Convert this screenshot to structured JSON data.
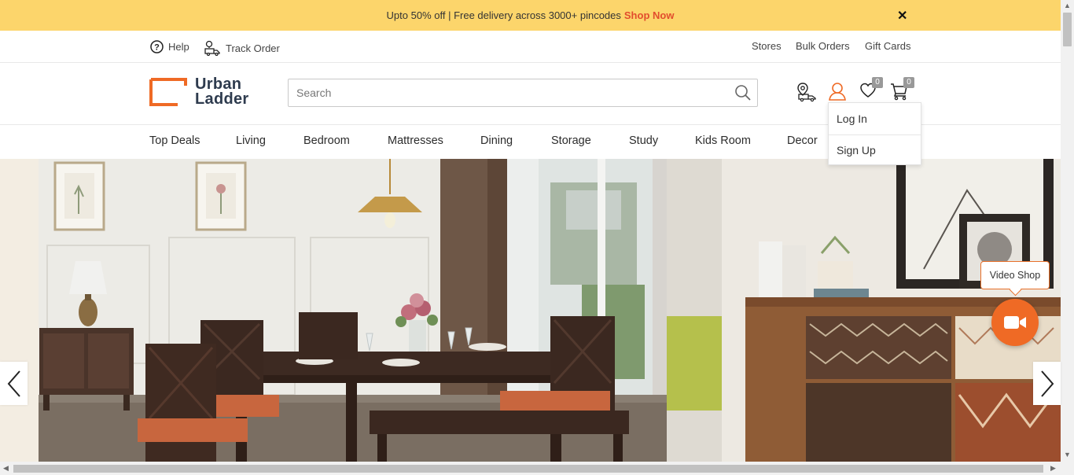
{
  "banner": {
    "text": "Upto 50% off | Free delivery across 3000+ pincodes",
    "link": "Shop Now",
    "close_icon": "close-icon"
  },
  "utility": {
    "help": "Help",
    "track_order": "Track Order",
    "stores": "Stores",
    "bulk_orders": "Bulk Orders",
    "gift_cards": "Gift Cards"
  },
  "header": {
    "logo_line1": "Urban",
    "logo_line2": "Ladder",
    "search_placeholder": "Search",
    "wishlist_count": "0",
    "cart_count": "0"
  },
  "account_menu": {
    "login": "Log In",
    "signup": "Sign Up"
  },
  "nav": {
    "items": [
      "Top Deals",
      "Living",
      "Bedroom",
      "Mattresses",
      "Dining",
      "Storage",
      "Study",
      "Kids Room",
      "Decor"
    ]
  },
  "video": {
    "label": "Video Shop"
  },
  "colors": {
    "banner_bg": "#fcd56b",
    "accent": "#e8702a",
    "shop_now": "#e24d2d"
  }
}
